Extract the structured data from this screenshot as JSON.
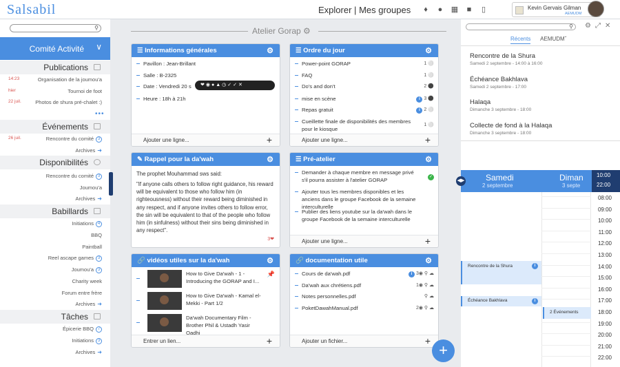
{
  "app": {
    "logo": "Salsabil"
  },
  "topnav": {
    "explore": "Explorer",
    "sep": "|",
    "groups": "Mes groupes"
  },
  "user": {
    "name": "Kevin Gervais Gilman",
    "group": "AEMUDM"
  },
  "sidebar": {
    "header": "Comité Activité",
    "sections": [
      {
        "title": "Publications",
        "items": [
          {
            "date": "14:23",
            "label": "Organisation de la joumou'a"
          },
          {
            "date": "hier",
            "label": "Tournoi de foot"
          },
          {
            "date": "22 juil.",
            "label": "Photos de shura pré-chalet :)"
          }
        ],
        "more": "•••"
      },
      {
        "title": "Événements",
        "items": [
          {
            "date": "26 juil.",
            "label": "Rencontre du comité",
            "badge": "3"
          },
          {
            "date": "",
            "label": "Archives",
            "arrow": true
          }
        ]
      },
      {
        "title": "Disponibilités",
        "items": [
          {
            "label": "Rencontre du comité",
            "badge": "3"
          },
          {
            "label": "Joumou'a"
          },
          {
            "label": "Archives",
            "arrow": true
          }
        ]
      },
      {
        "title": "Babillards",
        "items": [
          {
            "label": "Initiations",
            "badge": "4"
          },
          {
            "label": "BBQ"
          },
          {
            "label": "Paintball"
          },
          {
            "label": "Reel ascape games",
            "badge": "3"
          },
          {
            "label": "Joumou'a",
            "badge": "3"
          },
          {
            "label": "Charity week"
          },
          {
            "label": "Forum entre frère"
          },
          {
            "label": "Archives",
            "arrow": true
          }
        ]
      },
      {
        "title": "Tâches",
        "items": [
          {
            "label": "Épicerie BBQ",
            "badge": "7"
          },
          {
            "label": "Initiations",
            "badge": "3"
          },
          {
            "label": "Archives",
            "arrow": true
          }
        ]
      }
    ]
  },
  "main": {
    "title": "Atelier Gorap",
    "cards": {
      "info": {
        "title": "Informations générales",
        "items": [
          "Pavillon : Jean-Brillant",
          "Salle : B-2325",
          "Date : Vendredi 20 s",
          "Heure : 18h à 21h"
        ],
        "footer": "Ajouter une ligne..."
      },
      "agenda": {
        "title": "Ordre du jour",
        "items": [
          {
            "label": "Power-point GORAP",
            "count": "1"
          },
          {
            "label": "FAQ",
            "count": "1"
          },
          {
            "label": "Do's and don't",
            "count": "2"
          },
          {
            "label": "mise en scène",
            "count": "3",
            "info": true
          },
          {
            "label": "Repas gratuit",
            "count": "2",
            "info": true
          },
          {
            "label": "Cueillette finale de disponibilités des membres pour le kiosque",
            "count": "1"
          }
        ],
        "footer": "Ajouter une ligne..."
      },
      "reminder": {
        "title": "Rappel pour la da'wah",
        "p1": "The prophet Mouhammad sws said:",
        "p2": "\"If anyone calls others to follow right guidance, his reward will be equivalent to those who follow him (in righteousness) without their reward being diminished in any respect, and if anyone invites others to follow error, the sin will be equivalent to that of the people who follow him (in sinfulness) without their sins being diminished in any respect\".",
        "likes": "3"
      },
      "pre": {
        "title": "Pré-atelier",
        "items": [
          "Demander à chaque membre en message privé s'il pourra assister à l'atelier GORAP",
          "Ajouter tous les membres disponibles et les anciens dans le groupe Facebook de la semaine interculturelle",
          "Publier des liens youtube sur la da'wah dans le groupe Facebook de la semaine interculturelle"
        ],
        "footer": "Ajouter une ligne..."
      },
      "videos": {
        "title": "vidéos utiles sur la da'wah",
        "items": [
          "How to Give Da'wah - 1 - Introducing the GORAP and I...",
          "How to Give Da'wah - Kamal el-Mekki - Part 1/2",
          "Da'wah Documentary Film - Brother Phil & Ustadh Yasir Qadhi"
        ],
        "footer": "Entrer un lien..."
      },
      "docs": {
        "title": "documentation utile",
        "items": [
          {
            "label": "Cours de da'wah.pdf",
            "count": "3",
            "info": true
          },
          {
            "label": "Da'wah aux chrétiens.pdf",
            "count": "1"
          },
          {
            "label": "Notes personnelles.pdf",
            "count": ""
          },
          {
            "label": "PoketDawahManual.pdf",
            "count": "2"
          }
        ],
        "footer": "Ajouter un fichier..."
      }
    }
  },
  "right": {
    "tabs": [
      "Récents",
      "AEMUDM"
    ],
    "events": [
      {
        "title": "Rencontre de la Shura",
        "sub": "Samedi 2 septembre - 14:00 à 16:00"
      },
      {
        "title": "Échéance Bakhlava",
        "sub": "Samedi 2 septembre - 17:00"
      },
      {
        "title": "Halaqa",
        "sub": "Dimanche 3 septembre - 18:00"
      },
      {
        "title": "Collecte de fond à la Halaqa",
        "sub": "Dimanche 3 septembre - 18:00"
      }
    ],
    "calendar": {
      "day1": "Samedi",
      "day1sub": "2 septembre",
      "day2": "Diman",
      "day2sub": "3 septe",
      "range_start": "10:00",
      "range_end": "22:00",
      "hours": [
        "08:00",
        "09:00",
        "10:00",
        "11:00",
        "12:00",
        "13:00",
        "14:00",
        "15:00",
        "16:00",
        "17:00",
        "18:00",
        "19:00",
        "20:00",
        "21:00",
        "22:00"
      ],
      "events": [
        {
          "label": "Rencontre de la Shura"
        },
        {
          "label": "Échéance Bakhlava"
        },
        {
          "label": "2 Événements"
        }
      ]
    }
  }
}
